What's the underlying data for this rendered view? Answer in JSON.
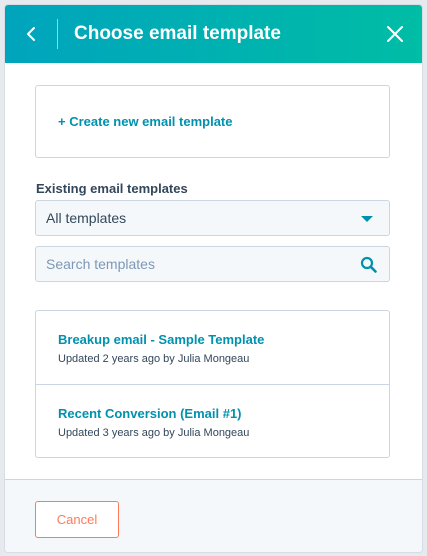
{
  "colors": {
    "header_gradient_start": "#00a4bd",
    "header_gradient_end": "#00bda5",
    "link": "#0091ae",
    "cancel_accent": "#ff7a59",
    "text": "#33475b"
  },
  "header": {
    "title": "Choose email template",
    "back_icon": "chevron-left-icon",
    "close_icon": "close-icon"
  },
  "create": {
    "label": "+ Create new email template"
  },
  "existing": {
    "section_label": "Existing email templates",
    "filter_value": "All templates",
    "search_placeholder": "Search templates",
    "search_icon": "search-icon"
  },
  "templates": [
    {
      "name": "Breakup email - Sample Template",
      "meta": "Updated 2 years ago by Julia Mongeau"
    },
    {
      "name": "Recent Conversion (Email #1)",
      "meta": "Updated 3 years ago by Julia Mongeau"
    }
  ],
  "footer": {
    "cancel_label": "Cancel"
  }
}
